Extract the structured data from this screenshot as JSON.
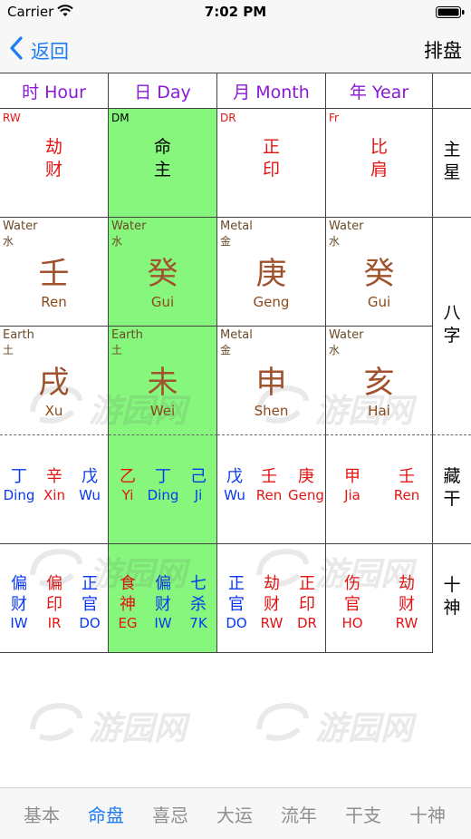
{
  "status_bar": {
    "carrier": "Carrier",
    "time": "7:02 PM"
  },
  "nav": {
    "back_label": "返回",
    "right_label": "排盘"
  },
  "columns": [
    {
      "header": "时 Hour",
      "ten_god_abbr": "RW",
      "ten_god": [
        "劫",
        "财"
      ],
      "stem": {
        "element_en": "Water",
        "element_cn": "水",
        "char": "壬",
        "pinyin": "Ren"
      },
      "branch": {
        "element_en": "Earth",
        "element_cn": "土",
        "char": "戌",
        "pinyin": "Xu"
      },
      "hidden_stems": [
        {
          "char": "丁",
          "pinyin": "Ding",
          "color": "blue"
        },
        {
          "char": "辛",
          "pinyin": "Xin",
          "color": "red"
        },
        {
          "char": "戊",
          "pinyin": "Wu",
          "color": "blue"
        }
      ],
      "hidden_gods": [
        {
          "c1": "偏",
          "c2": "财",
          "abbr": "IW",
          "color": "blue"
        },
        {
          "c1": "偏",
          "c2": "印",
          "abbr": "IR",
          "color": "red"
        },
        {
          "c1": "正",
          "c2": "官",
          "abbr": "DO",
          "color": "blue"
        }
      ]
    },
    {
      "header": "日 Day",
      "ten_god_abbr": "DM",
      "ten_god": [
        "命",
        "主"
      ],
      "stem": {
        "element_en": "Water",
        "element_cn": "水",
        "char": "癸",
        "pinyin": "Gui"
      },
      "branch": {
        "element_en": "Earth",
        "element_cn": "土",
        "char": "未",
        "pinyin": "Wei"
      },
      "hidden_stems": [
        {
          "char": "乙",
          "pinyin": "Yi",
          "color": "red"
        },
        {
          "char": "丁",
          "pinyin": "Ding",
          "color": "blue"
        },
        {
          "char": "己",
          "pinyin": "Ji",
          "color": "blue"
        }
      ],
      "hidden_gods": [
        {
          "c1": "食",
          "c2": "神",
          "abbr": "EG",
          "color": "red"
        },
        {
          "c1": "偏",
          "c2": "财",
          "abbr": "IW",
          "color": "blue"
        },
        {
          "c1": "七",
          "c2": "杀",
          "abbr": "7K",
          "color": "blue"
        }
      ]
    },
    {
      "header": "月 Month",
      "ten_god_abbr": "DR",
      "ten_god": [
        "正",
        "印"
      ],
      "stem": {
        "element_en": "Metal",
        "element_cn": "金",
        "char": "庚",
        "pinyin": "Geng"
      },
      "branch": {
        "element_en": "Metal",
        "element_cn": "金",
        "char": "申",
        "pinyin": "Shen"
      },
      "hidden_stems": [
        {
          "char": "戊",
          "pinyin": "Wu",
          "color": "blue"
        },
        {
          "char": "壬",
          "pinyin": "Ren",
          "color": "red"
        },
        {
          "char": "庚",
          "pinyin": "Geng",
          "color": "red"
        }
      ],
      "hidden_gods": [
        {
          "c1": "正",
          "c2": "官",
          "abbr": "DO",
          "color": "blue"
        },
        {
          "c1": "劫",
          "c2": "财",
          "abbr": "RW",
          "color": "red"
        },
        {
          "c1": "正",
          "c2": "印",
          "abbr": "DR",
          "color": "red"
        }
      ]
    },
    {
      "header": "年 Year",
      "ten_god_abbr": "Fr",
      "ten_god": [
        "比",
        "肩"
      ],
      "stem": {
        "element_en": "Water",
        "element_cn": "水",
        "char": "癸",
        "pinyin": "Gui"
      },
      "branch": {
        "element_en": "Water",
        "element_cn": "水",
        "char": "亥",
        "pinyin": "Hai"
      },
      "hidden_stems": [
        {
          "char": "甲",
          "pinyin": "Jia",
          "color": "red"
        },
        {
          "char": "壬",
          "pinyin": "Ren",
          "color": "red"
        }
      ],
      "hidden_gods": [
        {
          "c1": "伤",
          "c2": "官",
          "abbr": "HO",
          "color": "red"
        },
        {
          "c1": "劫",
          "c2": "财",
          "abbr": "RW",
          "color": "red"
        }
      ]
    }
  ],
  "side_labels": {
    "main_star": [
      "主",
      "星"
    ],
    "eight_chars": [
      "八",
      "字"
    ],
    "hidden_stems": [
      "藏",
      "干"
    ],
    "ten_gods": [
      "十",
      "神"
    ]
  },
  "watermark_text": "游园网",
  "tabs": [
    "基本",
    "命盘",
    "喜忌",
    "大运",
    "流年",
    "干支",
    "十神"
  ],
  "active_tab": "命盘",
  "colors": {
    "accent": "#1e7cf2",
    "day_highlight": "#86f67d",
    "header_text": "#8a18d6",
    "red_text": "#e41414",
    "blue_text": "#0a38f0",
    "stem_text": "#a0522d"
  }
}
